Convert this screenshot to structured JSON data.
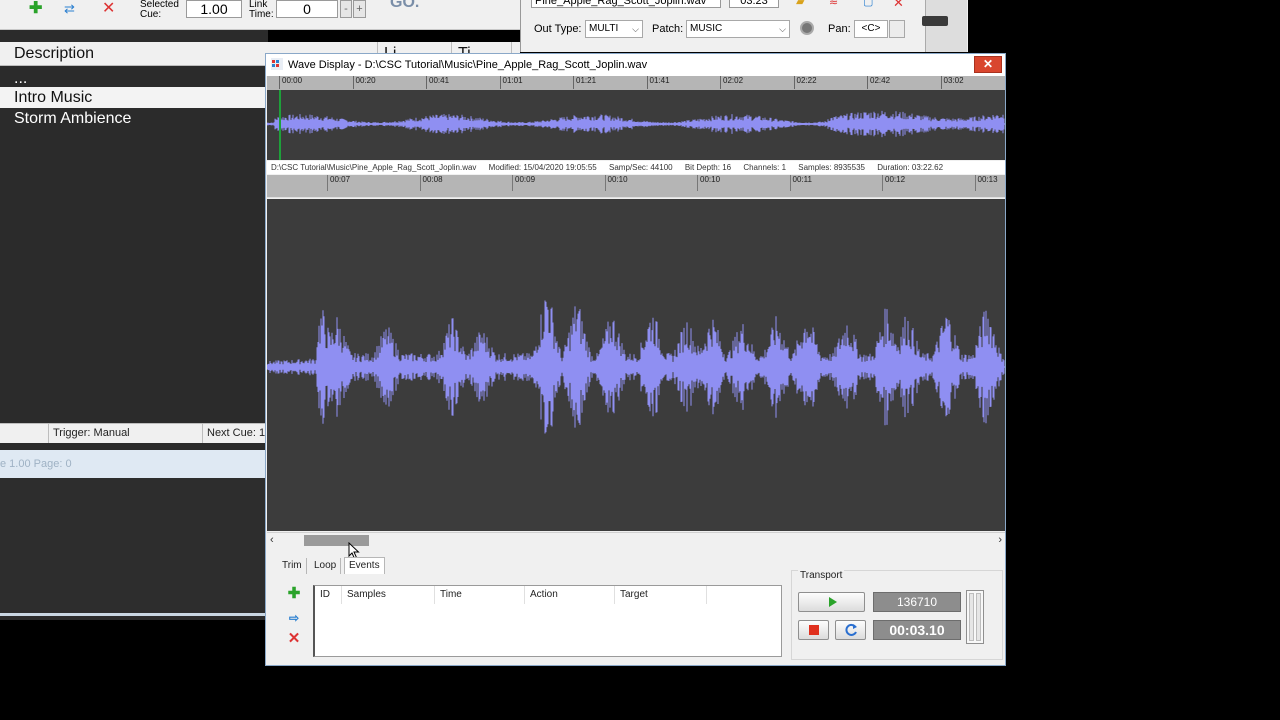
{
  "bg_toolbar": {
    "selected_cue_label_1": "Selected",
    "selected_cue_label_2": "Cue:",
    "selected_cue_value": "1.00",
    "link_time_label_1": "Link",
    "link_time_label_2": "Time:",
    "link_time_value": "0",
    "minus": "-",
    "plus": "+",
    "go_label": "GO."
  },
  "cue_list": {
    "col_description": "Description",
    "col_link": "Li",
    "col_time": "Ti",
    "rows": [
      {
        "label": "..."
      },
      {
        "label": "Intro Music"
      },
      {
        "label": "Storm Ambience"
      }
    ]
  },
  "status_bar": {
    "trigger": "Trigger: Manual",
    "next_cue": "Next Cue: 1.",
    "page_info": "e 1.00 Page: 0"
  },
  "bg_right": {
    "file_name": "Pine_Apple_Rag_Scott_Joplin.wav",
    "duration": "03:23",
    "out_type_label": "Out Type:",
    "out_type_value": "MULTI",
    "patch_label": "Patch:",
    "patch_value": "MUSIC",
    "pan_label": "Pan:",
    "pan_value": "<C>"
  },
  "wave_window": {
    "title": "Wave Display - D:\\CSC Tutorial\\Music\\Pine_Apple_Rag_Scott_Joplin.wav",
    "close": "✕",
    "overview_ticks": [
      "00:00",
      "00:20",
      "00:41",
      "01:01",
      "01:21",
      "01:41",
      "02:02",
      "02:22",
      "02:42",
      "03:02"
    ],
    "info": {
      "path": "D:\\CSC Tutorial\\Music\\Pine_Apple_Rag_Scott_Joplin.wav",
      "modified": "Modified:  15/04/2020 19:05:55",
      "samp_sec": "Samp/Sec:  44100",
      "bit_depth": "Bit Depth:  16",
      "channels": "Channels:  1",
      "samples": "Samples:  8935535",
      "duration": "Duration:  03:22.62"
    },
    "main_ticks": [
      "00:07",
      "00:08",
      "00:09",
      "00:10",
      "00:10",
      "00:11",
      "00:12",
      "00:13"
    ],
    "wave_color": "#8f8ff2",
    "cursor_color": "#1ea03a"
  },
  "tabs": [
    {
      "label": "Trim"
    },
    {
      "label": "Loop"
    },
    {
      "label": "Events"
    }
  ],
  "events": {
    "columns": [
      "ID",
      "Samples",
      "Time",
      "Action",
      "Target"
    ],
    "add_icon": "plus-icon",
    "insert_icon": "insert-arrow-icon",
    "delete_icon": "delete-x-icon"
  },
  "transport": {
    "label": "Transport",
    "samples_display": "136710",
    "time_display": "00:03.10"
  }
}
